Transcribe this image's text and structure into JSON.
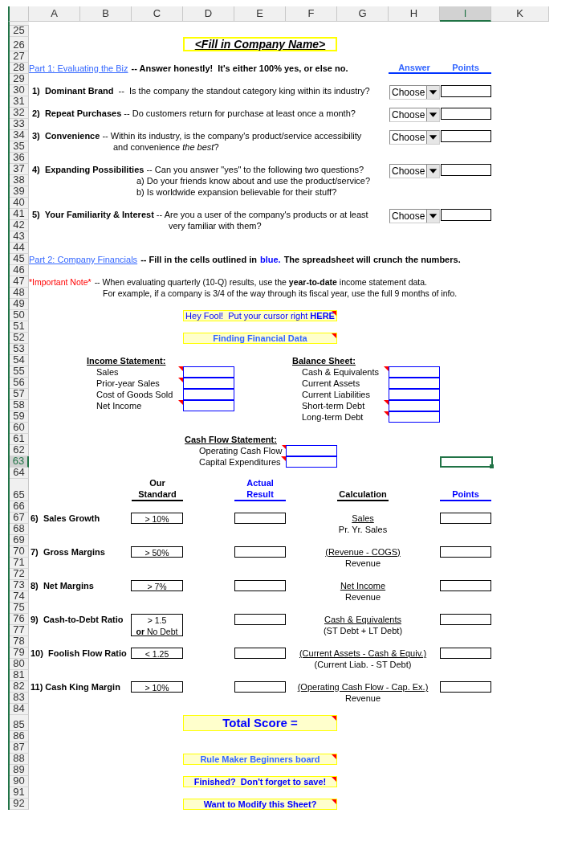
{
  "column_headers": [
    {
      "label": "A",
      "selected": false
    },
    {
      "label": "B",
      "selected": false
    },
    {
      "label": "C",
      "selected": false
    },
    {
      "label": "D",
      "selected": false
    },
    {
      "label": "E",
      "selected": false
    },
    {
      "label": "F",
      "selected": false
    },
    {
      "label": "G",
      "selected": false
    },
    {
      "label": "H",
      "selected": false
    },
    {
      "label": "I",
      "selected": true
    },
    {
      "label": "K",
      "selected": false
    }
  ],
  "row_numbers": [
    {
      "label": "25",
      "selected": false
    },
    {
      "label": "26",
      "selected": false
    },
    {
      "label": "27",
      "selected": false
    },
    {
      "label": "28",
      "selected": false
    },
    {
      "label": "29",
      "selected": false
    },
    {
      "label": "30",
      "selected": false
    },
    {
      "label": "31",
      "selected": false
    },
    {
      "label": "32",
      "selected": false
    },
    {
      "label": "33",
      "selected": false
    },
    {
      "label": "34",
      "selected": false
    },
    {
      "label": "35",
      "selected": false
    },
    {
      "label": "36",
      "selected": false
    },
    {
      "label": "37",
      "selected": false
    },
    {
      "label": "38",
      "selected": false
    },
    {
      "label": "39",
      "selected": false
    },
    {
      "label": "40",
      "selected": false
    },
    {
      "label": "41",
      "selected": false
    },
    {
      "label": "42",
      "selected": false
    },
    {
      "label": "43",
      "selected": false
    },
    {
      "label": "44",
      "selected": false
    },
    {
      "label": "45",
      "selected": false
    },
    {
      "label": "46",
      "selected": false
    },
    {
      "label": "47",
      "selected": false
    },
    {
      "label": "48",
      "selected": false
    },
    {
      "label": "49",
      "selected": false
    },
    {
      "label": "50",
      "selected": false
    },
    {
      "label": "51",
      "selected": false
    },
    {
      "label": "52",
      "selected": false
    },
    {
      "label": "53",
      "selected": false
    },
    {
      "label": "54",
      "selected": false
    },
    {
      "label": "55",
      "selected": false
    },
    {
      "label": "56",
      "selected": false
    },
    {
      "label": "57",
      "selected": false
    },
    {
      "label": "58",
      "selected": false
    },
    {
      "label": "59",
      "selected": false
    },
    {
      "label": "60",
      "selected": false
    },
    {
      "label": "61",
      "selected": false
    },
    {
      "label": "62",
      "selected": false
    },
    {
      "label": "63",
      "selected": true
    },
    {
      "label": "64",
      "selected": false
    },
    {
      "label": "65",
      "selected": false
    },
    {
      "label": "66",
      "selected": false
    },
    {
      "label": "67",
      "selected": false
    },
    {
      "label": "68",
      "selected": false
    },
    {
      "label": "69",
      "selected": false
    },
    {
      "label": "70",
      "selected": false
    },
    {
      "label": "71",
      "selected": false
    },
    {
      "label": "72",
      "selected": false
    },
    {
      "label": "73",
      "selected": false
    },
    {
      "label": "74",
      "selected": false
    },
    {
      "label": "75",
      "selected": false
    },
    {
      "label": "76",
      "selected": false
    },
    {
      "label": "77",
      "selected": false
    },
    {
      "label": "78",
      "selected": false
    },
    {
      "label": "79",
      "selected": false
    },
    {
      "label": "80",
      "selected": false
    },
    {
      "label": "81",
      "selected": false
    },
    {
      "label": "82",
      "selected": false
    },
    {
      "label": "83",
      "selected": false
    },
    {
      "label": "84",
      "selected": false
    },
    {
      "label": "85",
      "selected": false
    },
    {
      "label": "86",
      "selected": false
    },
    {
      "label": "87",
      "selected": false
    },
    {
      "label": "88",
      "selected": false
    },
    {
      "label": "89",
      "selected": false
    },
    {
      "label": "90",
      "selected": false
    },
    {
      "label": "91",
      "selected": false
    },
    {
      "label": "92",
      "selected": false
    }
  ],
  "company_name": "<Fill in Company Name>",
  "part1": {
    "link": "Part 1:  Evaluating the Biz",
    "text": "-- Answer honestly!  It's either 100% yes, or else no.",
    "answer_heading": "Answer",
    "points_heading": "Points"
  },
  "questions": [
    {
      "lines": [
        "**1)  Dominant Brand**  --  Is the company the standout category king within its industry?"
      ],
      "answer": "Choose"
    },
    {
      "lines": [
        "**2)  Repeat Purchases** -- Do customers return for purchase at least once a month?"
      ],
      "answer": "Choose"
    },
    {
      "lines": [
        "**3)  Convenience** -- Within its industry, is the company's product/service accessibility",
        "and convenience *the best*?"
      ],
      "answer": "Choose"
    },
    {
      "lines": [
        "**4)  Expanding Possibilities** -- Can you answer \"yes\" to the following two questions?",
        "a) Do your friends know about and use the product/service?",
        "b) Is worldwide expansion believable for their stuff?"
      ],
      "answer": "Choose"
    },
    {
      "lines": [
        "**5)  Your Familiarity & Interest** -- Are you a user of the company's products or at least",
        "very familiar with them?"
      ],
      "answer": "Choose"
    }
  ],
  "part2": {
    "link": "Part 2:  Company Financials",
    "text_before": "-- Fill in the cells outlined in",
    "highlight": "blue.",
    "text_after": "The spreadsheet will crunch the numbers."
  },
  "note": {
    "label": "*Important Note*",
    "text": "-- When evaluating quarterly (10-Q) results, use the **year-to-date** income statement data.",
    "text_2": "For example, if a company is 3/4 of the way through its fiscal year, use the full 9 months of info."
  },
  "financial_buttons": [
    {
      "label": "Hey Fool!  Put your cursor right **HERE**",
      "kind": "plain",
      "comment": true
    },
    {
      "label": "Finding Financial Data",
      "kind": "link",
      "comment": true
    }
  ],
  "income_statement": {
    "heading": "Income Statement:",
    "items": [
      {
        "label": "Sales",
        "comment": true
      },
      {
        "label": "Prior-year Sales",
        "comment": true
      },
      {
        "label": "Cost of Goods Sold",
        "comment": false
      },
      {
        "label": "Net Income",
        "comment": true
      }
    ]
  },
  "balance_sheet": {
    "heading": "Balance Sheet:",
    "items": [
      {
        "label": "Cash & Equivalents",
        "comment": true
      },
      {
        "label": "Current Assets",
        "comment": false
      },
      {
        "label": "Current Liabilities",
        "comment": false
      },
      {
        "label": "Short-term Debt",
        "comment": true
      },
      {
        "label": "Long-term Debt",
        "comment": true
      }
    ]
  },
  "cash_flow": {
    "heading": "Cash Flow Statement:",
    "items": [
      {
        "label": "Operating Cash Flow",
        "comment": true
      },
      {
        "label": "Capital Expenditures",
        "comment": true
      }
    ]
  },
  "metrics_headings": {
    "standard": "Our\nStandard",
    "actual": "Actual\nResult",
    "calculation": "Calculation",
    "points": "Points"
  },
  "metrics": [
    {
      "name": "6)  Sales Growth",
      "standard": "> 10%",
      "calc_top": "Sales",
      "calc_bottom": "Pr. Yr. Sales"
    },
    {
      "name": "7)  Gross Margins",
      "standard": "> 50%",
      "calc_top": "(Revenue - COGS)",
      "calc_bottom": "Revenue"
    },
    {
      "name": "8)  Net Margins",
      "standard": "> 7%",
      "calc_top": "Net Income",
      "calc_bottom": "Revenue"
    },
    {
      "name": "9)  Cash-to-Debt Ratio",
      "standard": "> 1.5\n**or** No Debt",
      "calc_top": "Cash & Equivalents",
      "calc_bottom": "(ST Debt + LT Debt)"
    },
    {
      "name": "10)  Foolish Flow Ratio",
      "standard": "< 1.25",
      "calc_top": "(Current Assets - Cash & Equiv.)",
      "calc_bottom": "(Current Liab. - ST Debt)"
    },
    {
      "name": "11) Cash King Margin",
      "standard": "> 10%",
      "calc_top": "(Operating Cash Flow - Cap. Ex.)",
      "calc_bottom": "Revenue"
    }
  ],
  "total_score": {
    "label": "Total Score =",
    "comment": true
  },
  "bottom_buttons": [
    {
      "label": "Rule Maker Beginners board",
      "kind": "link",
      "comment": true
    },
    {
      "label": "Finished?  Don't forget to save!",
      "kind": "plain",
      "comment": true
    },
    {
      "label": "Want to Modify this Sheet?",
      "kind": "plain",
      "comment": true
    }
  ]
}
